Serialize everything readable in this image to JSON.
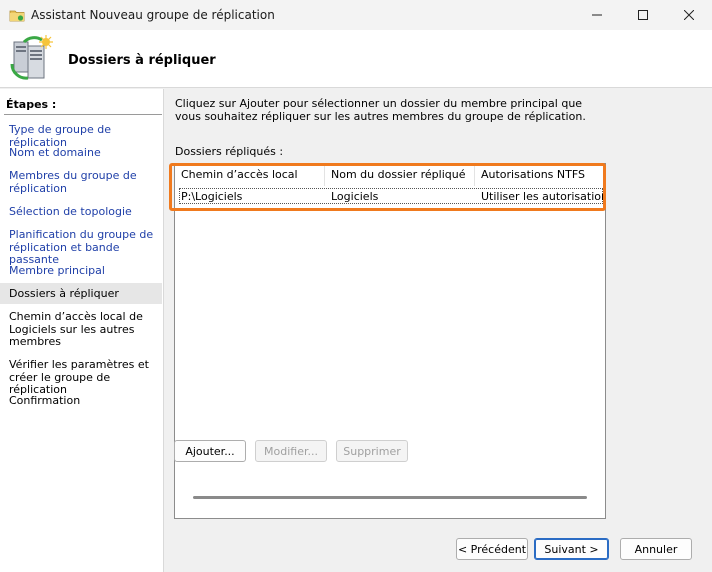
{
  "window": {
    "title": "Assistant Nouveau groupe de réplication",
    "icon": "folder-replication-icon"
  },
  "header": {
    "title": "Dossiers à répliquer",
    "icon": "server-replication-icon"
  },
  "sidebar": {
    "label": "Étapes :",
    "steps": [
      {
        "label": "Type de groupe de réplication",
        "state": "link"
      },
      {
        "label": "Nom et domaine",
        "state": "link"
      },
      {
        "label": "Membres du groupe de réplication",
        "state": "link"
      },
      {
        "label": "Sélection de topologie",
        "state": "link"
      },
      {
        "label": "Planification du groupe de réplication et bande passante",
        "state": "link"
      },
      {
        "label": "Membre principal",
        "state": "link"
      },
      {
        "label": "Dossiers à répliquer",
        "state": "current"
      },
      {
        "label": "Chemin d’accès local de Logiciels sur les autres membres",
        "state": "pending"
      },
      {
        "label": "Vérifier les paramètres et créer le groupe de réplication",
        "state": "pending"
      },
      {
        "label": "Confirmation",
        "state": "pending"
      }
    ]
  },
  "main": {
    "description": "Cliquez sur Ajouter pour sélectionner un dossier du membre principal que vous souhaitez répliquer sur les autres membres du groupe de réplication.",
    "list_label": "Dossiers répliqués :",
    "columns": [
      "Chemin d’accès local",
      "Nom du dossier répliqué",
      "Autorisations NTFS"
    ],
    "rows": [
      {
        "path": "P:\\Logiciels",
        "name": "Logiciels",
        "ntfs": "Utiliser les autorisations..."
      }
    ],
    "buttons": {
      "add": "Ajouter...",
      "edit": "Modifier...",
      "remove": "Supprimer"
    }
  },
  "footer": {
    "back": "< Précédent",
    "next": "Suivant >",
    "cancel": "Annuler"
  },
  "colors": {
    "highlight": "#f07a1e",
    "link": "#1f3fa8",
    "primary_border": "#2b6cc4"
  }
}
